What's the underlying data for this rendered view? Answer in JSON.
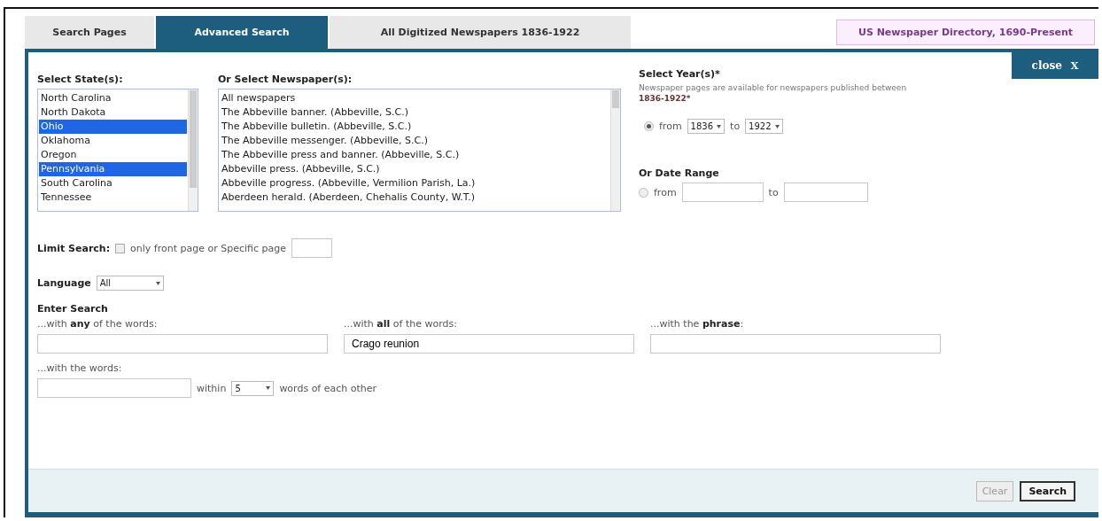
{
  "tabs": [
    {
      "label": "Search Pages",
      "selected": false
    },
    {
      "label": "Advanced Search",
      "selected": true
    },
    {
      "label": "All Digitized Newspapers 1836-1922",
      "selected": false
    }
  ],
  "directory_link": "US Newspaper Directory, 1690-Present",
  "close_button": {
    "label": "close",
    "icon": "X"
  },
  "states": {
    "label": "Select State(s):",
    "items": [
      {
        "name": "North Carolina",
        "selected": false
      },
      {
        "name": "North Dakota",
        "selected": false
      },
      {
        "name": "Ohio",
        "selected": true
      },
      {
        "name": "Oklahoma",
        "selected": false
      },
      {
        "name": "Oregon",
        "selected": false
      },
      {
        "name": "Pennsylvania",
        "selected": true
      },
      {
        "name": "South Carolina",
        "selected": false
      },
      {
        "name": "Tennessee",
        "selected": false
      }
    ]
  },
  "newspapers": {
    "label": "Or Select Newspaper(s):",
    "items": [
      {
        "name": "All newspapers",
        "selected": false
      },
      {
        "name": "The Abbeville banner. (Abbeville, S.C.)",
        "selected": false
      },
      {
        "name": "The Abbeville bulletin. (Abbeville, S.C.)",
        "selected": false
      },
      {
        "name": "The Abbeville messenger. (Abbeville, S.C.)",
        "selected": false
      },
      {
        "name": "The Abbeville press and banner. (Abbeville, S.C.)",
        "selected": false
      },
      {
        "name": "Abbeville press. (Abbeville, S.C.)",
        "selected": false
      },
      {
        "name": "Abbeville progress. (Abbeville, Vermilion Parish, La.)",
        "selected": false
      },
      {
        "name": "Aberdeen herald. (Aberdeen, Chehalis County, W.T.)",
        "selected": false
      }
    ]
  },
  "years": {
    "label": "Select Year(s)*",
    "note": "Newspaper pages are available for newspapers published between",
    "note_range": "1836-1922*",
    "selected": true,
    "from_label": "from",
    "from": "1836",
    "to_label": "to",
    "to": "1922"
  },
  "date_range": {
    "label": "Or Date Range",
    "selected": false,
    "from_label": "from",
    "to_label": "to"
  },
  "limit": {
    "label": "Limit Search:",
    "checked": false,
    "text": "only front page or Specific page"
  },
  "language": {
    "label": "Language",
    "value": "All"
  },
  "enter_search": {
    "label": "Enter Search",
    "fields": [
      {
        "label": "...with **any** of the words:"
      },
      {
        "label": "...with **all** of the words:",
        "value": "Crago reunion"
      },
      {
        "label": "...with the **phrase**:"
      }
    ],
    "proximity": {
      "label": "...with the words:",
      "within": "within",
      "distance": "5",
      "suffix": "words of each other"
    }
  },
  "buttons": [
    {
      "label": "Clear",
      "kind": "secondary"
    },
    {
      "label": "Search",
      "kind": "primary"
    }
  ]
}
